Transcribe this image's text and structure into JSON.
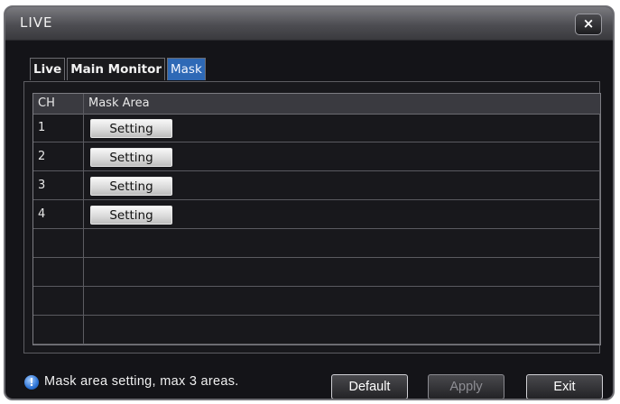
{
  "window": {
    "title": "LIVE",
    "close_label": "×"
  },
  "tabs": [
    {
      "label": "Live",
      "active": false
    },
    {
      "label": "Main Monitor",
      "active": false
    },
    {
      "label": "Mask",
      "active": true
    }
  ],
  "table": {
    "headers": {
      "ch": "CH",
      "mask_area": "Mask Area"
    },
    "rows": [
      {
        "ch": "1",
        "button": "Setting"
      },
      {
        "ch": "2",
        "button": "Setting"
      },
      {
        "ch": "3",
        "button": "Setting"
      },
      {
        "ch": "4",
        "button": "Setting"
      },
      {
        "ch": "",
        "button": ""
      },
      {
        "ch": "",
        "button": ""
      },
      {
        "ch": "",
        "button": ""
      },
      {
        "ch": "",
        "button": ""
      }
    ]
  },
  "status": {
    "icon": "info-icon",
    "text": "Mask area setting, max 3 areas."
  },
  "buttons": {
    "default": "Default",
    "apply": "Apply",
    "exit": "Exit"
  },
  "colors": {
    "accent_tab": "#2e69b6",
    "window_bg": "#141418"
  }
}
